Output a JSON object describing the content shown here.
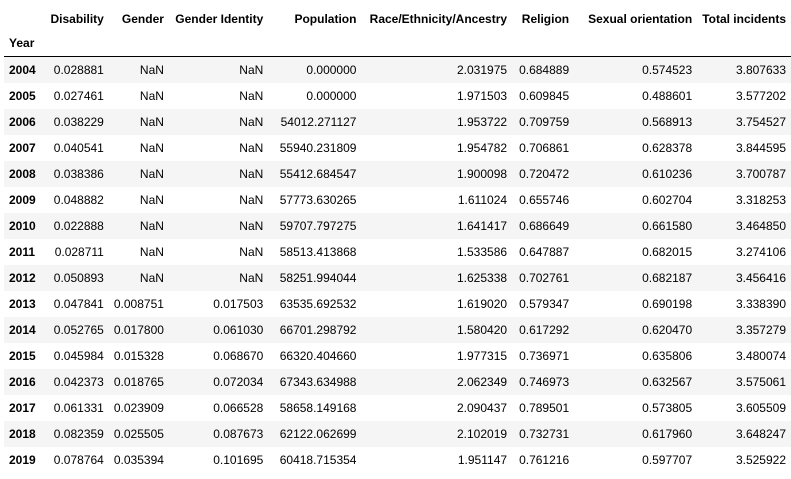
{
  "table": {
    "index_name": "Year",
    "columns": [
      "Disability",
      "Gender",
      "Gender Identity",
      "Population",
      "Race/Ethnicity/Ancestry",
      "Religion",
      "Sexual orientation",
      "Total incidents"
    ],
    "rows": [
      {
        "year": "2004",
        "cells": [
          "0.028881",
          "NaN",
          "NaN",
          "0.000000",
          "2.031975",
          "0.684889",
          "0.574523",
          "3.807633"
        ]
      },
      {
        "year": "2005",
        "cells": [
          "0.027461",
          "NaN",
          "NaN",
          "0.000000",
          "1.971503",
          "0.609845",
          "0.488601",
          "3.577202"
        ]
      },
      {
        "year": "2006",
        "cells": [
          "0.038229",
          "NaN",
          "NaN",
          "54012.271127",
          "1.953722",
          "0.709759",
          "0.568913",
          "3.754527"
        ]
      },
      {
        "year": "2007",
        "cells": [
          "0.040541",
          "NaN",
          "NaN",
          "55940.231809",
          "1.954782",
          "0.706861",
          "0.628378",
          "3.844595"
        ]
      },
      {
        "year": "2008",
        "cells": [
          "0.038386",
          "NaN",
          "NaN",
          "55412.684547",
          "1.900098",
          "0.720472",
          "0.610236",
          "3.700787"
        ]
      },
      {
        "year": "2009",
        "cells": [
          "0.048882",
          "NaN",
          "NaN",
          "57773.630265",
          "1.611024",
          "0.655746",
          "0.602704",
          "3.318253"
        ]
      },
      {
        "year": "2010",
        "cells": [
          "0.022888",
          "NaN",
          "NaN",
          "59707.797275",
          "1.641417",
          "0.686649",
          "0.661580",
          "3.464850"
        ]
      },
      {
        "year": "2011",
        "cells": [
          "0.028711",
          "NaN",
          "NaN",
          "58513.413868",
          "1.533586",
          "0.647887",
          "0.682015",
          "3.274106"
        ]
      },
      {
        "year": "2012",
        "cells": [
          "0.050893",
          "NaN",
          "NaN",
          "58251.994044",
          "1.625338",
          "0.702761",
          "0.682187",
          "3.456416"
        ]
      },
      {
        "year": "2013",
        "cells": [
          "0.047841",
          "0.008751",
          "0.017503",
          "63535.692532",
          "1.619020",
          "0.579347",
          "0.690198",
          "3.338390"
        ]
      },
      {
        "year": "2014",
        "cells": [
          "0.052765",
          "0.017800",
          "0.061030",
          "66701.298792",
          "1.580420",
          "0.617292",
          "0.620470",
          "3.357279"
        ]
      },
      {
        "year": "2015",
        "cells": [
          "0.045984",
          "0.015328",
          "0.068670",
          "66320.404660",
          "1.977315",
          "0.736971",
          "0.635806",
          "3.480074"
        ]
      },
      {
        "year": "2016",
        "cells": [
          "0.042373",
          "0.018765",
          "0.072034",
          "67343.634988",
          "2.062349",
          "0.746973",
          "0.632567",
          "3.575061"
        ]
      },
      {
        "year": "2017",
        "cells": [
          "0.061331",
          "0.023909",
          "0.066528",
          "58658.149168",
          "2.090437",
          "0.789501",
          "0.573805",
          "3.605509"
        ]
      },
      {
        "year": "2018",
        "cells": [
          "0.082359",
          "0.025505",
          "0.087673",
          "62122.062699",
          "2.102019",
          "0.732731",
          "0.617960",
          "3.648247"
        ]
      },
      {
        "year": "2019",
        "cells": [
          "0.078764",
          "0.035394",
          "0.101695",
          "60418.715354",
          "1.951147",
          "0.761216",
          "0.597707",
          "3.525922"
        ]
      }
    ]
  }
}
